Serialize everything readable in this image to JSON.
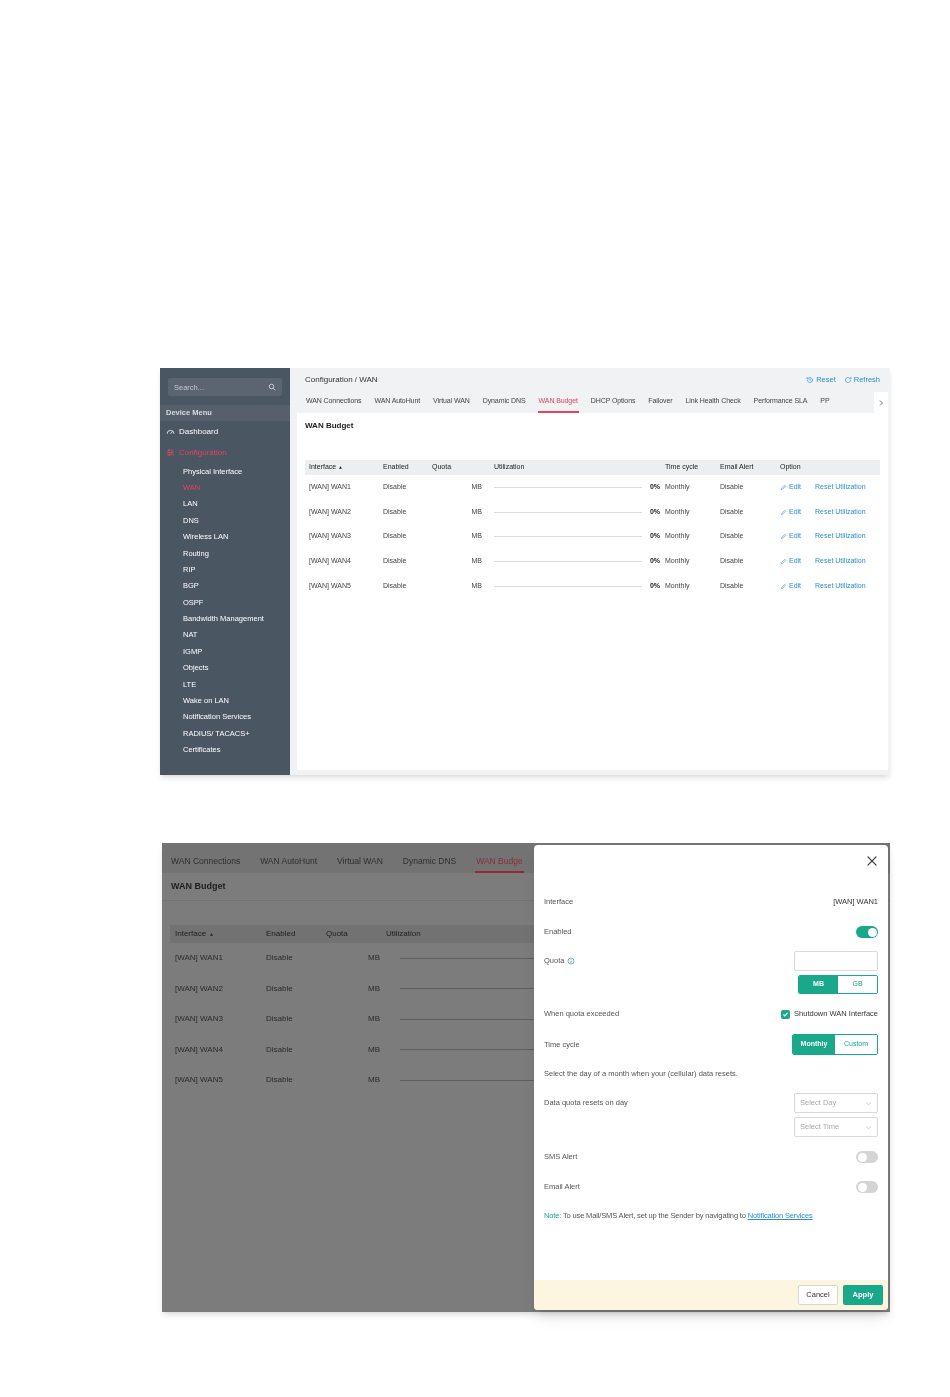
{
  "shot1": {
    "sidebar": {
      "search_placeholder": "Search...",
      "section": "Device Menu",
      "items": [
        {
          "label": "Dashboard",
          "kind": "dashboard",
          "selected": false
        },
        {
          "label": "Configuration",
          "kind": "configuration",
          "selected": true,
          "children": [
            {
              "label": "Physical Interface",
              "selected": false
            },
            {
              "label": "WAN",
              "selected": true
            },
            {
              "label": "LAN",
              "selected": false
            },
            {
              "label": "DNS",
              "selected": false
            },
            {
              "label": "Wireless LAN",
              "selected": false
            },
            {
              "label": "Routing",
              "selected": false
            },
            {
              "label": "RIP",
              "selected": false
            },
            {
              "label": "BGP",
              "selected": false
            },
            {
              "label": "OSPF",
              "selected": false
            },
            {
              "label": "Bandwidth Management",
              "selected": false
            },
            {
              "label": "NAT",
              "selected": false
            },
            {
              "label": "IGMP",
              "selected": false
            },
            {
              "label": "Objects",
              "selected": false
            },
            {
              "label": "LTE",
              "selected": false
            },
            {
              "label": "Wake on LAN",
              "selected": false
            },
            {
              "label": "Notification Services",
              "selected": false
            },
            {
              "label": "RADIUS/ TACACS+",
              "selected": false
            },
            {
              "label": "Certificates",
              "selected": false
            }
          ]
        }
      ]
    },
    "breadcrumb": "Configuration / WAN",
    "actions": [
      {
        "label": "Reset",
        "kind": "reset"
      },
      {
        "label": "Refresh",
        "kind": "refresh"
      }
    ],
    "tabs": [
      {
        "label": "WAN Connections",
        "selected": false
      },
      {
        "label": "WAN AutoHunt",
        "selected": false
      },
      {
        "label": "Virtual WAN",
        "selected": false
      },
      {
        "label": "Dynamic DNS",
        "selected": false
      },
      {
        "label": "WAN Budget",
        "selected": true
      },
      {
        "label": "DHCP Options",
        "selected": false
      },
      {
        "label": "Failover",
        "selected": false
      },
      {
        "label": "Link Health Check",
        "selected": false
      },
      {
        "label": "Performance SLA",
        "selected": false
      },
      {
        "label": "PP",
        "selected": false
      }
    ],
    "card_title": "WAN Budget",
    "table": {
      "columns": [
        {
          "label": "Interface",
          "sorted": true
        },
        {
          "label": "Enabled",
          "sorted": false
        },
        {
          "label": "Quota",
          "sorted": false
        },
        {
          "label": "Utilization",
          "sorted": false
        },
        {
          "label": "Time cycle",
          "sorted": false
        },
        {
          "label": "Email Alert",
          "sorted": false
        },
        {
          "label": "Option",
          "sorted": false
        }
      ],
      "rows": [
        {
          "interface": "[WAN] WAN1",
          "enabled": "Disable",
          "quota_unit": "MB",
          "level": 0,
          "utilization": "0%",
          "time_cycle": "Monthly",
          "email_alert": "Disable",
          "options": [
            "Edit",
            "Reset Utilization"
          ]
        },
        {
          "interface": "[WAN] WAN2",
          "enabled": "Disable",
          "quota_unit": "MB",
          "level": 0,
          "utilization": "0%",
          "time_cycle": "Monthly",
          "email_alert": "Disable",
          "options": [
            "Edit",
            "Reset Utilization"
          ]
        },
        {
          "interface": "[WAN] WAN3",
          "enabled": "Disable",
          "quota_unit": "MB",
          "level": 0,
          "utilization": "0%",
          "time_cycle": "Monthly",
          "email_alert": "Disable",
          "options": [
            "Edit",
            "Reset Utilization"
          ]
        },
        {
          "interface": "[WAN] WAN4",
          "enabled": "Disable",
          "quota_unit": "MB",
          "level": 0,
          "utilization": "0%",
          "time_cycle": "Monthly",
          "email_alert": "Disable",
          "options": [
            "Edit",
            "Reset Utilization"
          ]
        },
        {
          "interface": "[WAN] WAN5",
          "enabled": "Disable",
          "quota_unit": "MB",
          "level": 0,
          "utilization": "0%",
          "time_cycle": "Monthly",
          "email_alert": "Disable",
          "options": [
            "Edit",
            "Reset Utilization"
          ]
        }
      ]
    }
  },
  "shot2": {
    "tabs": [
      {
        "label": "WAN Connections",
        "selected": false
      },
      {
        "label": "WAN AutoHunt",
        "selected": false
      },
      {
        "label": "Virtual WAN",
        "selected": false
      },
      {
        "label": "Dynamic DNS",
        "selected": false
      },
      {
        "label": "WAN Budge",
        "selected": true
      }
    ],
    "card_title": "WAN Budget",
    "table": {
      "columns": [
        {
          "label": "Interface",
          "sorted": true
        },
        {
          "label": "Enabled",
          "sorted": false
        },
        {
          "label": "Quota",
          "sorted": false
        },
        {
          "label": "Utilization",
          "sorted": false
        }
      ],
      "rows": [
        {
          "interface": "[WAN] WAN1",
          "enabled": "Disable",
          "quota_unit": "MB",
          "level": 0
        },
        {
          "interface": "[WAN] WAN2",
          "enabled": "Disable",
          "quota_unit": "MB",
          "level": 0
        },
        {
          "interface": "[WAN] WAN3",
          "enabled": "Disable",
          "quota_unit": "MB",
          "level": 0
        },
        {
          "interface": "[WAN] WAN4",
          "enabled": "Disable",
          "quota_unit": "MB",
          "level": 0
        },
        {
          "interface": "[WAN] WAN5",
          "enabled": "Disable",
          "quota_unit": "MB",
          "level": 0
        }
      ]
    },
    "drawer": {
      "fields": [
        {
          "kind": "text",
          "label": "Interface",
          "value": "[WAN] WAN1"
        },
        {
          "kind": "toggle",
          "label": "Enabled",
          "on": true
        },
        {
          "kind": "quota",
          "label": "Quota",
          "units": [
            {
              "label": "MB",
              "selected": true
            },
            {
              "label": "GB",
              "selected": false
            }
          ]
        },
        {
          "kind": "checkbox",
          "label": "When quota exceeded",
          "checked": true,
          "text": "Shutdown WAN Interface"
        },
        {
          "kind": "segment",
          "label": "Time cycle",
          "options": [
            {
              "label": "Monthly",
              "selected": true
            },
            {
              "label": "Custom",
              "selected": false
            }
          ]
        },
        {
          "kind": "help",
          "text": "Select the day of a month when your (cellular) data resets."
        },
        {
          "kind": "selects",
          "label": "Data quota resets on day",
          "placeholders": [
            "Select Day",
            "Select Time"
          ]
        },
        {
          "kind": "toggle",
          "label": "SMS Alert",
          "on": false
        },
        {
          "kind": "toggle",
          "label": "Email Alert",
          "on": false
        }
      ],
      "note": {
        "label": "Note:",
        "text": "To use Mail/SMS Alert, set up the Sender by navigating to",
        "link": "Notification Services"
      },
      "buttons": [
        {
          "label": "Cancel",
          "kind": "secondary"
        },
        {
          "label": "Apply",
          "kind": "primary"
        }
      ]
    }
  }
}
